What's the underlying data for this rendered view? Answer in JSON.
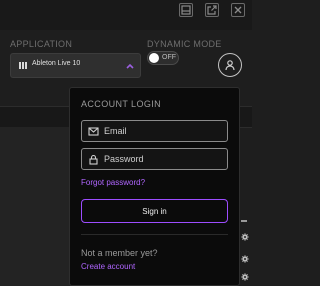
{
  "header": {
    "window_buttons": [
      {
        "icon": "window-icon"
      },
      {
        "icon": "external-link-icon"
      },
      {
        "icon": "close-icon"
      }
    ]
  },
  "controls": {
    "application_label": "APPLICATION",
    "application_value": "Ableton Live 10",
    "dynamic_mode_label": "DYNAMIC MODE",
    "dynamic_mode_state": "OFF",
    "user_icon": "user-icon"
  },
  "login": {
    "title": "ACCOUNT LOGIN",
    "email_placeholder": "Email",
    "email_value": "",
    "password_placeholder": "Password",
    "password_value": "",
    "forgot_password": "Forgot password?",
    "sign_in": "Sign in",
    "not_member": "Not a member yet?",
    "create_account": "Create account"
  },
  "colors": {
    "accent": "#9d4dff",
    "link": "#b066ff",
    "background": "#1e1e1e",
    "popup_background": "#0b0b0b"
  }
}
